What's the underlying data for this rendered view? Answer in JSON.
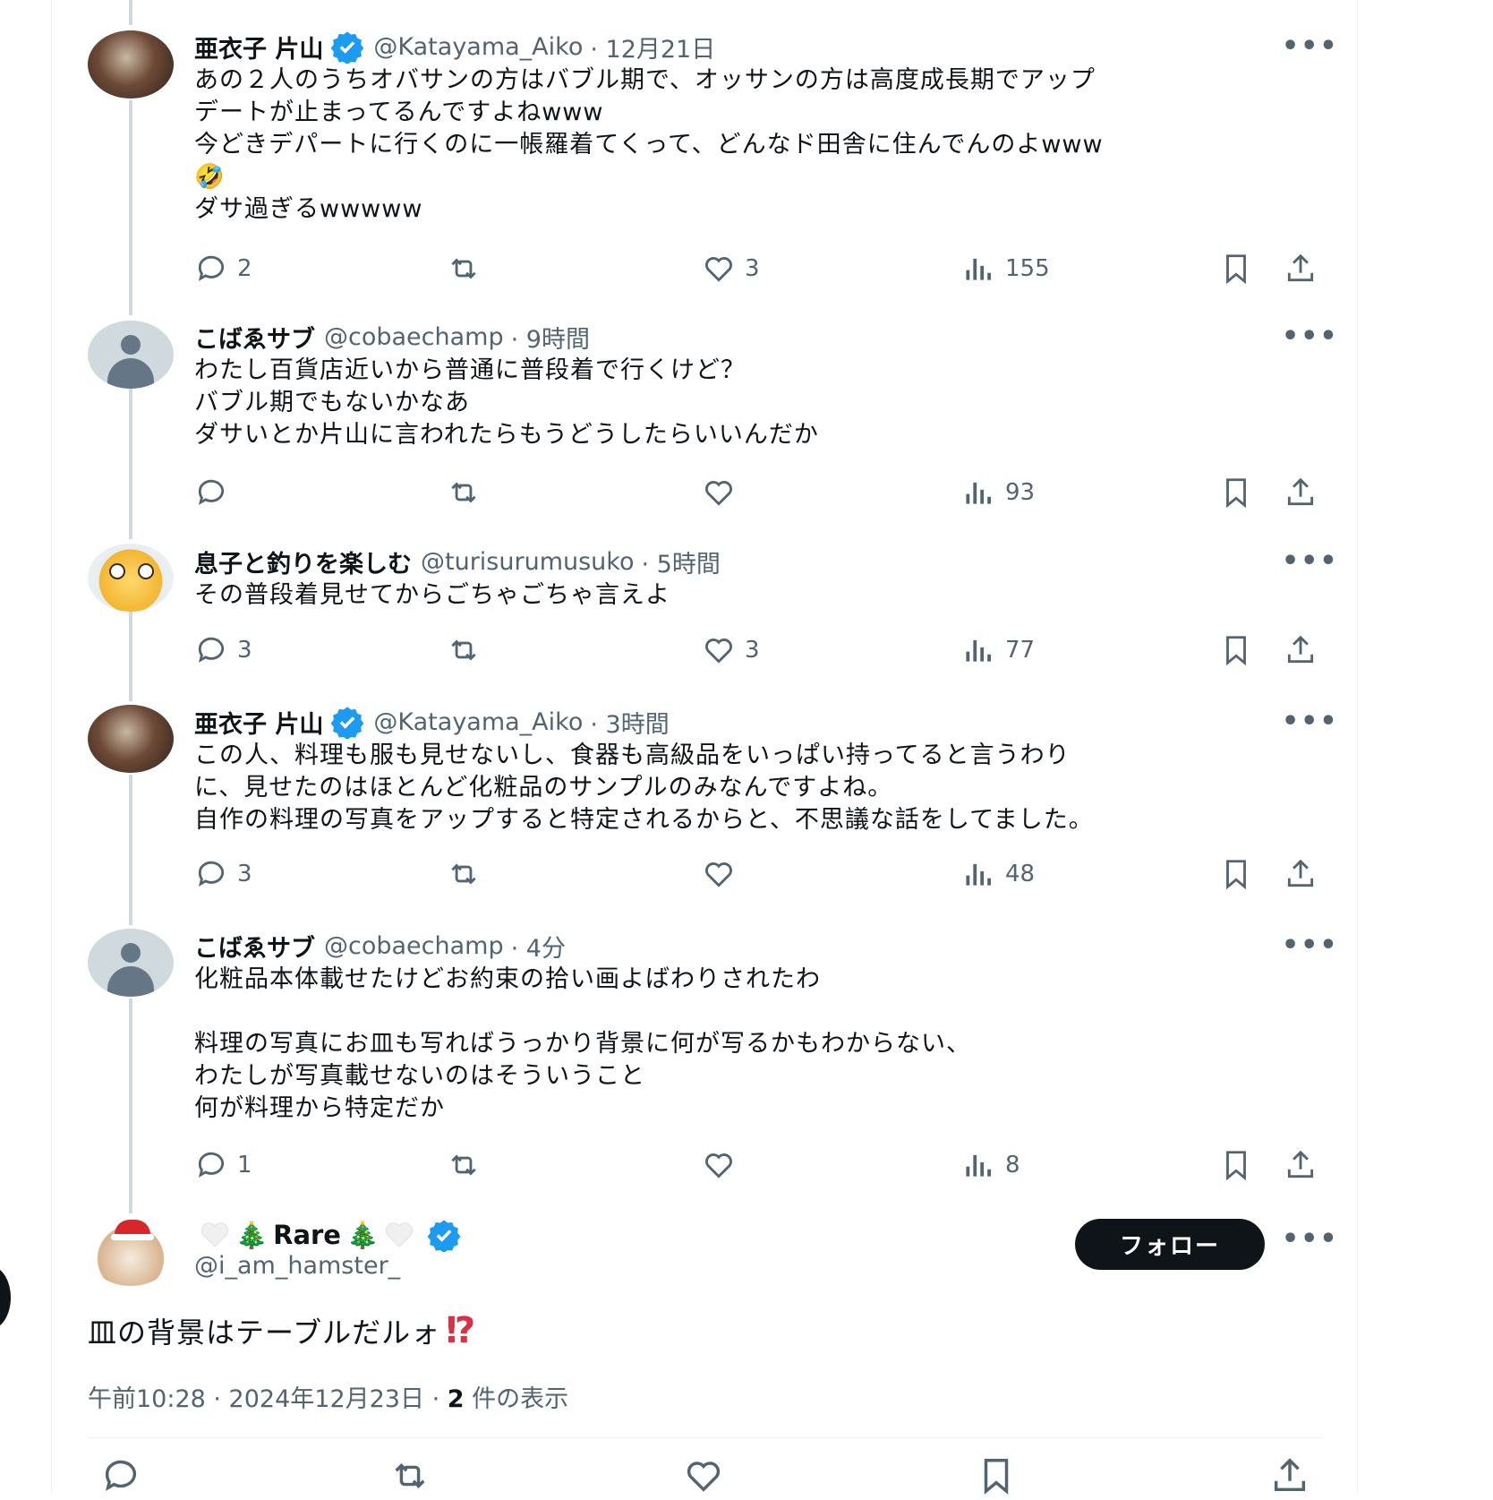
{
  "colors": {
    "accent": "#1d9bf0",
    "text": "#0f1419",
    "muted": "#536471",
    "thread_line": "#cfd9de"
  },
  "replies": [
    {
      "name": "亜衣子 片山",
      "verified": true,
      "handle": "@Katayama_Aiko",
      "time": "· 12月21日",
      "text_lines": [
        "あの２人のうちオバサンの方はバブル期で、オッサンの方は高度成長期でアップ",
        "デートが止まってるんですよねwww",
        "今どきデパートに行くのに一帳羅着てくって、どんなド田舎に住んでんのよwww",
        "🤣",
        "ダサ過ぎるwwwww"
      ],
      "replies": "2",
      "retweets": "",
      "likes": "3",
      "views": "155"
    },
    {
      "name": "こばゑサブ",
      "verified": false,
      "handle": "@cobaechamp",
      "time": "· 9時間",
      "text_lines": [
        "わたし百貨店近いから普通に普段着で行くけど？",
        "バブル期でもないかなあ",
        "ダサいとか片山に言われたらもうどうしたらいいんだか"
      ],
      "replies": "",
      "retweets": "",
      "likes": "",
      "views": "93"
    },
    {
      "name": "息子と釣りを楽しむ",
      "verified": false,
      "handle": "@turisurumusuko",
      "time": "· 5時間",
      "text_lines": [
        "その普段着見せてからごちゃごちゃ言えよ"
      ],
      "replies": "3",
      "retweets": "",
      "likes": "3",
      "views": "77"
    },
    {
      "name": "亜衣子 片山",
      "verified": true,
      "handle": "@Katayama_Aiko",
      "time": "· 3時間",
      "text_lines": [
        "この人、料理も服も見せないし、食器も高級品をいっぱい持ってると言うわり",
        "に、見せたのはほとんど化粧品のサンプルのみなんですよね。",
        "自作の料理の写真をアップすると特定されるからと、不思議な話をしてました。"
      ],
      "replies": "3",
      "retweets": "",
      "likes": "",
      "views": "48"
    },
    {
      "name": "こばゑサブ",
      "verified": false,
      "handle": "@cobaechamp",
      "time": "· 4分",
      "text_lines": [
        "化粧品本体載せたけどお約束の拾い画よばわりされたわ",
        "",
        "料理の写真にお皿も写ればうっかり背景に何が写るかもわからない、",
        "わたしが写真載せないのはそういうこと",
        "何が料理から特定だか"
      ],
      "replies": "1",
      "retweets": "",
      "likes": "",
      "views": "8"
    }
  ],
  "main_tweet": {
    "name_prefix": "🎄",
    "name": "Rare",
    "name_suffix": "🎄",
    "verified": true,
    "handle": "@i_am_hamster_",
    "follow_label": "フォロー",
    "text": "皿の背景はテーブルだルォ",
    "text_emoji": "⁉",
    "time": "午前10:28 · 2024年12月23日 · ",
    "views_count": "2",
    "views_label": " 件の表示"
  },
  "icons": [
    "reply-icon",
    "retweet-icon",
    "like-icon",
    "views-icon",
    "bookmark-icon",
    "share-icon",
    "more-icon",
    "verified-badge-icon"
  ]
}
